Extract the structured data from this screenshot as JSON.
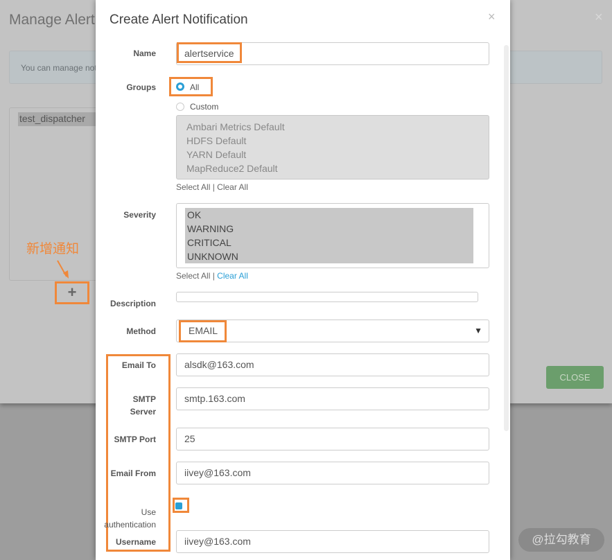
{
  "background": {
    "title": "Manage Alert",
    "info": "You can manage not",
    "notifications": [
      "test_dispatcher"
    ],
    "annotation": "新增通知",
    "close_label": "CLOSE",
    "watermark": "@拉勾教育"
  },
  "modal": {
    "title": "Create Alert Notification",
    "close": "×",
    "name": {
      "label": "Name",
      "value": "alertservice"
    },
    "groups": {
      "label": "Groups",
      "all": "All",
      "custom": "Custom",
      "selected": "All",
      "items": [
        "Ambari Metrics Default",
        "HDFS Default",
        "YARN Default",
        "MapReduce2 Default"
      ],
      "select_all": "Select All",
      "sep": "|",
      "clear_all": "Clear All"
    },
    "severity": {
      "label": "Severity",
      "items": [
        "OK",
        "WARNING",
        "CRITICAL",
        "UNKNOWN"
      ],
      "select_all": "Select All",
      "sep": "|",
      "clear_all": "Clear All"
    },
    "description": {
      "label": "Description",
      "value": ""
    },
    "method": {
      "label": "Method",
      "value": "EMAIL"
    },
    "email_to": {
      "label": "Email To",
      "value": "alsdk@163.com"
    },
    "smtp_server": {
      "label_1": "SMTP",
      "label_2": "Server",
      "value": "smtp.163.com"
    },
    "smtp_port": {
      "label": "SMTP Port",
      "value": "25"
    },
    "email_from": {
      "label": "Email From",
      "value": "iivey@163.com"
    },
    "use_auth": {
      "label_1": "Use",
      "label_2": "authentication",
      "checked": true
    },
    "username": {
      "label": "Username",
      "value": "iivey@163.com"
    }
  },
  "colors": {
    "accent": "#2a9fd6",
    "annotation": "#f0883a",
    "close_button": "#6b9e6c"
  }
}
